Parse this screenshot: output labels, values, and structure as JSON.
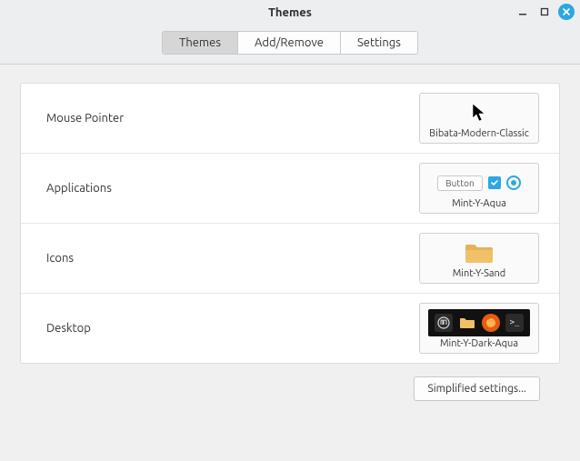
{
  "window": {
    "title": "Themes"
  },
  "tabs": {
    "themes": "Themes",
    "add_remove": "Add/Remove",
    "settings": "Settings"
  },
  "rows": {
    "mouse_pointer": {
      "label": "Mouse Pointer",
      "value": "Bibata-Modern-Classic"
    },
    "applications": {
      "label": "Applications",
      "value": "Mint-Y-Aqua",
      "preview_button": "Button"
    },
    "icons": {
      "label": "Icons",
      "value": "Mint-Y-Sand"
    },
    "desktop": {
      "label": "Desktop",
      "value": "Mint-Y-Dark-Aqua"
    }
  },
  "footer": {
    "simplified": "Simplified settings..."
  },
  "colors": {
    "accent": "#2ca7e0",
    "folder": "#f1c068"
  }
}
